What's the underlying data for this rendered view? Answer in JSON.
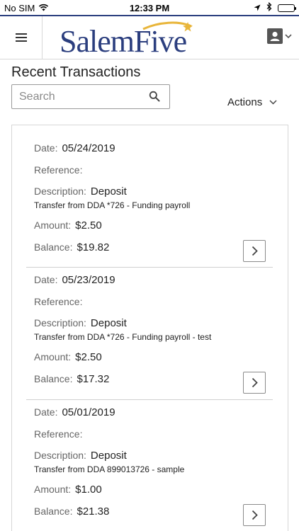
{
  "status_bar": {
    "carrier": "No SIM",
    "time": "12:33 PM"
  },
  "header": {
    "logo_text": "SalemFive",
    "brand_color": "#2b3e7e",
    "accent_color": "#e8b53a"
  },
  "page": {
    "title": "Recent Transactions"
  },
  "search": {
    "placeholder": "Search",
    "value": ""
  },
  "actions": {
    "label": "Actions"
  },
  "labels": {
    "date": "Date:",
    "reference": "Reference:",
    "description": "Description:",
    "amount": "Amount:",
    "balance": "Balance:"
  },
  "transactions": [
    {
      "date": "05/24/2019",
      "reference": "",
      "description": "Deposit",
      "detail": "Transfer from DDA *726 - Funding payroll",
      "amount": "$2.50",
      "balance": "$19.82"
    },
    {
      "date": "05/23/2019",
      "reference": "",
      "description": "Deposit",
      "detail": "Transfer from DDA *726 - Funding payroll - test",
      "amount": "$2.50",
      "balance": "$17.32"
    },
    {
      "date": "05/01/2019",
      "reference": "",
      "description": "Deposit",
      "detail": "Transfer from DDA 899013726 - sample",
      "amount": "$1.00",
      "balance": "$21.38"
    }
  ]
}
